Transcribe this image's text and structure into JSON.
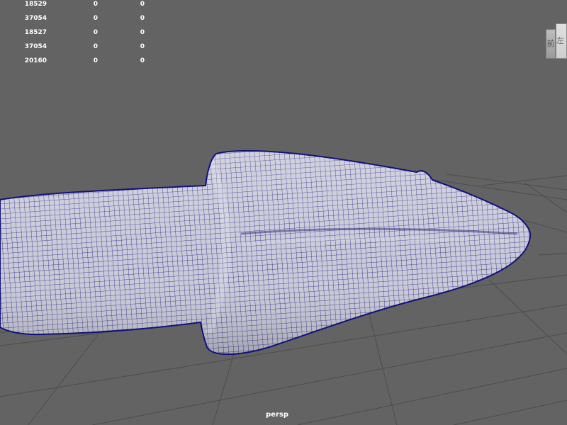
{
  "viewport": {
    "camera_name": "persp",
    "background_color": "#636363",
    "wireframe_color": "#1a1a8a",
    "mesh_color": "#c8c8d8"
  },
  "heads_up_display": {
    "rows": [
      {
        "values": [
          "18529",
          "0",
          "0"
        ]
      },
      {
        "values": [
          "37054",
          "0",
          "0"
        ]
      },
      {
        "values": [
          "18527",
          "0",
          "0"
        ]
      },
      {
        "values": [
          "37054",
          "0",
          "0"
        ]
      },
      {
        "values": [
          "20160",
          "0",
          "0"
        ]
      }
    ]
  },
  "view_cube": {
    "front_face_label": "前",
    "side_face_label": "左"
  }
}
